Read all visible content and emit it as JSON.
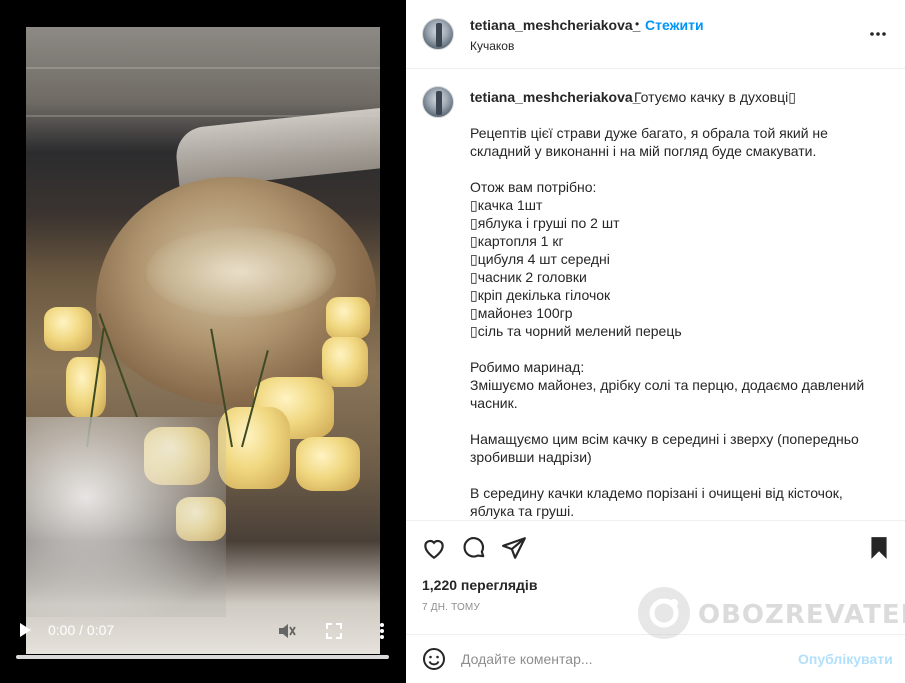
{
  "video": {
    "time": "0:00 / 0:07",
    "progress": 0
  },
  "header": {
    "username": "tetiana_meshcheriakova_",
    "separator": "•",
    "follow_label": "Стежити",
    "location": "Кучаков"
  },
  "caption": {
    "username": "tetiana_meshcheriakova_",
    "first_line": "Готуємо качку в духовці▯",
    "paragraphs": [
      "Рецептів цієї страви дуже багато, я обрала той який не складний у виконанні і на мій погляд буде смакувати.",
      "Отож вам потрібно:\n▯качка 1шт\n▯яблука і груші по 2 шт\n▯картопля 1 кг\n▯цибуля 4 шт середні\n▯часник 2 головки\n▯кріп декілька гілочок\n▯майонез 100гр\n▯сіль та чорний мелений перець",
      "Робимо маринад:\nЗмішуємо майонез, дрібку солі та перцю, додаємо давлений часник.",
      "Намащуємо цим всім качку в середині і зверху (попередньо зробивши надрізи)",
      "В середину качки кладемо порізані і очищені від кісточок, яблука та груші."
    ]
  },
  "stats": {
    "views": "1,220 переглядів",
    "date": "7 ДН. ТОМУ"
  },
  "comment": {
    "placeholder": "Додайте коментар...",
    "publish_label": "Опублікувати"
  },
  "watermark": {
    "text": "OBOZREVATEL"
  },
  "icons": {
    "like": "heart-icon",
    "comment": "comment-icon",
    "share": "send-icon",
    "save": "bookmark-icon",
    "more": "more-horizontal-icon",
    "emoji": "emoji-icon",
    "play": "play-icon",
    "mute": "volume-muted-icon",
    "fullscreen": "fullscreen-icon",
    "menu": "more-vertical-icon"
  },
  "colors": {
    "accent": "#0095f6",
    "publish_disabled": "#b2dffc",
    "text": "#262626",
    "muted": "#8e8e8e",
    "divider": "#efefef"
  }
}
